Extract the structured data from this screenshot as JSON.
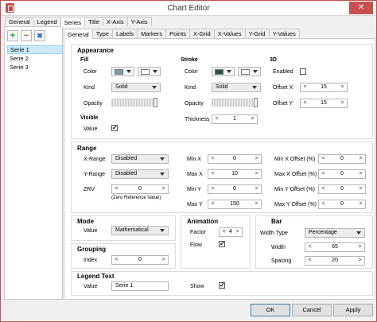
{
  "window": {
    "title": "Chart Editor",
    "close_glyph": "✕"
  },
  "main_tabs": [
    "General",
    "Legend",
    "Series",
    "Title",
    "X-Axis",
    "Y-Axis"
  ],
  "toolbar": {
    "add_glyph": "+",
    "remove_glyph": "−",
    "edit_glyph": "✖"
  },
  "series_list": [
    "Serie 1",
    "Serie 2",
    "Serie 3"
  ],
  "sub_tabs": [
    "General",
    "Type",
    "Labels",
    "Markers",
    "Points",
    "X-Grid",
    "X-Values",
    "Y-Grid",
    "Y-Values"
  ],
  "appearance": {
    "title": "Appearance",
    "fill": {
      "title": "Fill",
      "color_label": "Color",
      "kind_label": "Kind",
      "kind_value": "Solid",
      "opacity_label": "Opacity",
      "color_swatch": "#8496b0",
      "color_swatch2": "#ffffff"
    },
    "stroke": {
      "title": "Stroke",
      "color_label": "Color",
      "kind_label": "Kind",
      "kind_value": "Solid",
      "opacity_label": "Opacity",
      "thickness_label": "Thickness",
      "thickness_value": "1",
      "color_swatch": "#2f4f4f",
      "color_swatch2": "#ffffff"
    },
    "d3": {
      "title": "3D",
      "enabled_label": "Enabled",
      "offset_x_label": "Offset X",
      "offset_x_value": "15",
      "offset_y_label": "Offset Y",
      "offset_y_value": "15"
    },
    "visible": {
      "title": "Visible",
      "value_label": "Value"
    }
  },
  "range": {
    "title": "Range",
    "x_range_label": "X-Range",
    "x_range_value": "Disabled",
    "y_range_label": "Y-Range",
    "y_range_value": "Disabled",
    "zrv_label": "ZRV",
    "zrv_value": "0",
    "zrv_note": "(Zero Reference Value)",
    "min_x_label": "Min X",
    "min_x_value": "0",
    "max_x_label": "Max X",
    "max_x_value": "10",
    "min_y_label": "Min Y",
    "min_y_value": "0",
    "max_y_label": "Max Y",
    "max_y_value": "150",
    "min_x_off_label": "Min X Offset  (%)",
    "min_x_off_value": "0",
    "max_x_off_label": "Max X Offset  (%)",
    "max_x_off_value": "0",
    "min_y_off_label": "Min Y Offset  (%)",
    "min_y_off_value": "0",
    "max_y_off_label": "Max Y Offset  (%)",
    "max_y_off_value": "0"
  },
  "mode": {
    "title": "Mode",
    "value_label": "Value",
    "value": "Mathematical"
  },
  "animation": {
    "title": "Animation",
    "factor_label": "Factor",
    "factor_value": "4",
    "flow_label": "Flow"
  },
  "bar": {
    "title": "Bar",
    "width_type_label": "Width Type",
    "width_type_value": "Percentage",
    "width_label": "Width",
    "width_value": "65",
    "spacing_label": "Spacing",
    "spacing_value": "20"
  },
  "grouping": {
    "title": "Grouping",
    "index_label": "Index",
    "index_value": "0"
  },
  "legend_text": {
    "title": "Legend Text",
    "value_label": "Value",
    "value": "Serie 1",
    "show_label": "Show"
  },
  "buttons": {
    "ok": "OK",
    "cancel": "Cancel",
    "apply": "Apply"
  },
  "check_glyph": "✓",
  "arrow_left": "<",
  "arrow_right": ">"
}
